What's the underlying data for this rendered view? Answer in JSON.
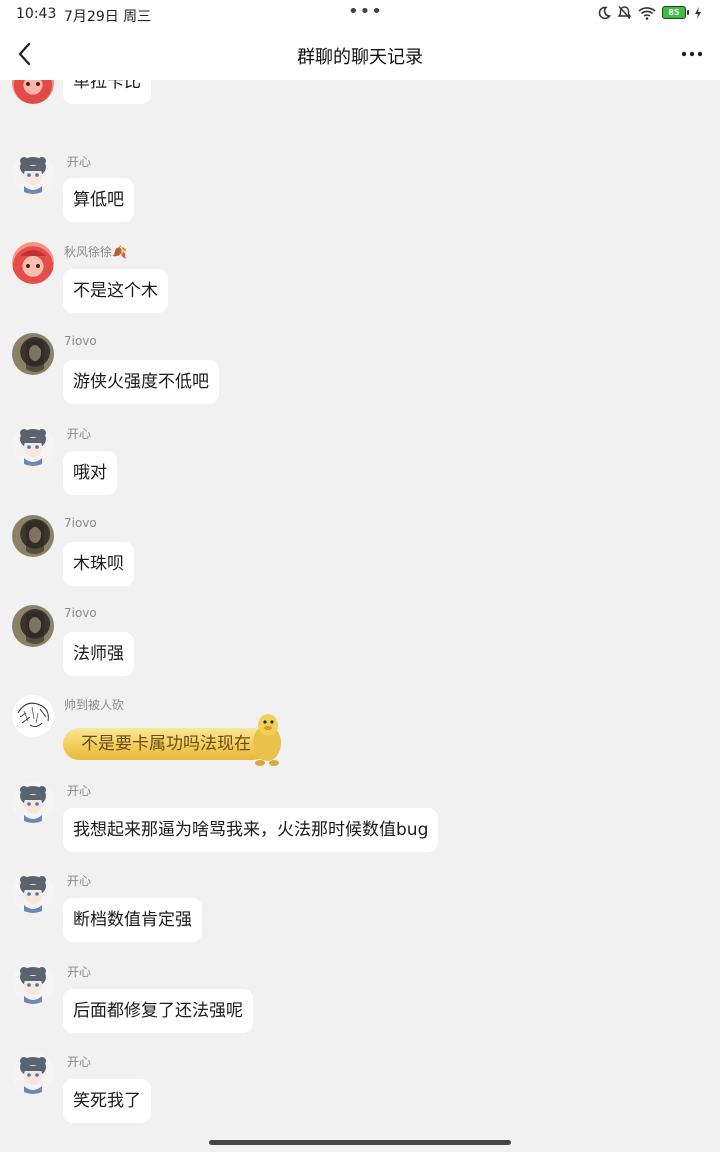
{
  "status_bar": {
    "time": "10:43",
    "date": "7月29日 周三",
    "center": "•••",
    "battery": "85"
  },
  "header": {
    "title": "群聊的聊天记录"
  },
  "messages": [
    {
      "sender": "",
      "text": "单拉卡比",
      "avatar": "red-hair-avatar"
    },
    {
      "sender": "开心",
      "text": "算低吧",
      "avatar": "anime-girl-avatar"
    },
    {
      "sender": "秋风徐徐🍂",
      "text": "不是这个木",
      "avatar": "red-hair-avatar"
    },
    {
      "sender": "7iovo",
      "text": "游侠火强度不低吧",
      "avatar": "photo-avatar"
    },
    {
      "sender": "开心",
      "text": "哦对",
      "avatar": "anime-girl-avatar"
    },
    {
      "sender": "7iovo",
      "text": "木珠呗",
      "avatar": "photo-avatar"
    },
    {
      "sender": "7iovo",
      "text": "法师强",
      "avatar": "photo-avatar"
    },
    {
      "sender": "帅到被人砍",
      "text": "不是要卡属功吗法现在",
      "avatar": "sketch-avatar",
      "style": "gold"
    },
    {
      "sender": "开心",
      "text": "我想起来那逼为啥骂我来，火法那时候数值bug",
      "avatar": "anime-girl-avatar"
    },
    {
      "sender": "开心",
      "text": "断档数值肯定强",
      "avatar": "anime-girl-avatar"
    },
    {
      "sender": "开心",
      "text": "后面都修复了还法强呢",
      "avatar": "anime-girl-avatar"
    },
    {
      "sender": "开心",
      "text": "笑死我了",
      "avatar": "anime-girl-avatar"
    }
  ]
}
